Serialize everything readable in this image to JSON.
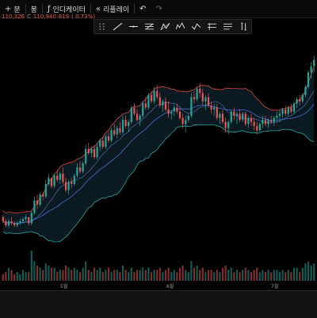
{
  "toolbar": {
    "timeframe": "분",
    "chart_type_label": "봉",
    "indicators_label": "인디케이터",
    "replay_label": "리플레이",
    "undo": "undo-icon",
    "redo": "redo-icon"
  },
  "ohlc": {
    "fragment1": "110,326",
    "close_prefix": "C",
    "close_value": "110,940",
    "change": "819",
    "change_pct": "( 0.73%)"
  },
  "drawing_tools": [
    "trend-line-icon",
    "horizontal-line-icon",
    "fib-retracement-icon",
    "pattern-icon",
    "elliott-wave-icon",
    "projection-icon",
    "brush-icon",
    "text-icon",
    "measure-icon"
  ],
  "x_axis": {
    "labels": [
      "5월",
      "6월",
      "7월"
    ]
  },
  "colors": {
    "up": "#26a69a",
    "down": "#ef5350",
    "band_upper": "#e0443b",
    "band_lower": "#26a69a",
    "middle": "#3a6bd6",
    "ma": "#6ea0ff",
    "band_fill": "#0c1d23"
  },
  "chart_data": {
    "type": "candlestick",
    "candles": [
      [
        100,
        101,
        97,
        98
      ],
      [
        98,
        99,
        95,
        96
      ],
      [
        96,
        99,
        95,
        98
      ],
      [
        98,
        100,
        96,
        97
      ],
      [
        97,
        98,
        95,
        96
      ],
      [
        96,
        98,
        95,
        97
      ],
      [
        97,
        99,
        96,
        98
      ],
      [
        98,
        100,
        97,
        99
      ],
      [
        99,
        101,
        98,
        100
      ],
      [
        100,
        99,
        96,
        97
      ],
      [
        97,
        103,
        96,
        102
      ],
      [
        102,
        110,
        101,
        108
      ],
      [
        108,
        111,
        104,
        106
      ],
      [
        106,
        112,
        105,
        111
      ],
      [
        111,
        112,
        108,
        110
      ],
      [
        110,
        118,
        109,
        116
      ],
      [
        116,
        121,
        115,
        119
      ],
      [
        119,
        118,
        114,
        115
      ],
      [
        115,
        121,
        114,
        120
      ],
      [
        120,
        123,
        117,
        118
      ],
      [
        118,
        122,
        116,
        121
      ],
      [
        121,
        124,
        116,
        117
      ],
      [
        117,
        119,
        112,
        113
      ],
      [
        113,
        118,
        111,
        117
      ],
      [
        117,
        119,
        114,
        116
      ],
      [
        116,
        121,
        115,
        120
      ],
      [
        120,
        126,
        119,
        124
      ],
      [
        124,
        127,
        121,
        122
      ],
      [
        122,
        127,
        121,
        126
      ],
      [
        126,
        135,
        125,
        133
      ],
      [
        133,
        136,
        130,
        131
      ],
      [
        131,
        134,
        129,
        133
      ],
      [
        133,
        135,
        128,
        129
      ],
      [
        129,
        136,
        128,
        134
      ],
      [
        134,
        138,
        132,
        137
      ],
      [
        137,
        139,
        133,
        134
      ],
      [
        134,
        140,
        133,
        139
      ],
      [
        139,
        141,
        136,
        137
      ],
      [
        137,
        143,
        136,
        142
      ],
      [
        142,
        145,
        139,
        140
      ],
      [
        140,
        144,
        138,
        143
      ],
      [
        143,
        146,
        140,
        141
      ],
      [
        141,
        149,
        140,
        147
      ],
      [
        147,
        149,
        143,
        144
      ],
      [
        144,
        147,
        141,
        146
      ],
      [
        146,
        154,
        145,
        153
      ],
      [
        153,
        155,
        149,
        150
      ],
      [
        150,
        152,
        146,
        147
      ],
      [
        147,
        150,
        144,
        149
      ],
      [
        149,
        156,
        148,
        155
      ],
      [
        155,
        158,
        152,
        153
      ],
      [
        153,
        160,
        152,
        159
      ],
      [
        159,
        161,
        155,
        156
      ],
      [
        156,
        163,
        155,
        161
      ],
      [
        161,
        164,
        157,
        158
      ],
      [
        158,
        160,
        153,
        154
      ],
      [
        154,
        157,
        151,
        156
      ],
      [
        156,
        158,
        151,
        152
      ],
      [
        152,
        156,
        148,
        150
      ],
      [
        150,
        152,
        147,
        151
      ],
      [
        151,
        154,
        149,
        153
      ],
      [
        153,
        155,
        150,
        151
      ],
      [
        151,
        153,
        147,
        148
      ],
      [
        148,
        150,
        143,
        145
      ],
      [
        145,
        149,
        141,
        147
      ],
      [
        147,
        150,
        146,
        149
      ],
      [
        149,
        160,
        148,
        158
      ],
      [
        158,
        161,
        155,
        157
      ],
      [
        157,
        163,
        156,
        162
      ],
      [
        162,
        165,
        158,
        160
      ],
      [
        160,
        162,
        154,
        156
      ],
      [
        156,
        159,
        152,
        158
      ],
      [
        158,
        160,
        153,
        154
      ],
      [
        154,
        156,
        150,
        152
      ],
      [
        152,
        155,
        149,
        153
      ],
      [
        153,
        155,
        147,
        148
      ],
      [
        148,
        151,
        145,
        150
      ],
      [
        150,
        152,
        145,
        146
      ],
      [
        146,
        148,
        141,
        143
      ],
      [
        143,
        147,
        140,
        146
      ],
      [
        146,
        152,
        145,
        151
      ],
      [
        151,
        153,
        147,
        149
      ],
      [
        149,
        151,
        145,
        150
      ],
      [
        150,
        152,
        146,
        147
      ],
      [
        147,
        151,
        146,
        150
      ],
      [
        150,
        151,
        144,
        145
      ],
      [
        145,
        149,
        143,
        148
      ],
      [
        148,
        150,
        144,
        146
      ],
      [
        146,
        148,
        142,
        144
      ],
      [
        144,
        146,
        140,
        142
      ],
      [
        142,
        146,
        141,
        145
      ],
      [
        145,
        149,
        143,
        147
      ],
      [
        147,
        149,
        144,
        145
      ],
      [
        145,
        148,
        143,
        147
      ],
      [
        147,
        149,
        145,
        146
      ],
      [
        146,
        149,
        144,
        148
      ],
      [
        148,
        151,
        146,
        149
      ],
      [
        149,
        152,
        146,
        150
      ],
      [
        150,
        153,
        148,
        152
      ],
      [
        152,
        154,
        149,
        150
      ],
      [
        150,
        154,
        149,
        153
      ],
      [
        153,
        155,
        150,
        151
      ],
      [
        151,
        156,
        150,
        155
      ],
      [
        155,
        158,
        153,
        157
      ],
      [
        157,
        159,
        154,
        156
      ],
      [
        156,
        160,
        155,
        159
      ],
      [
        159,
        164,
        158,
        163
      ],
      [
        163,
        171,
        162,
        170
      ],
      [
        170,
        175,
        167,
        173
      ],
      [
        173,
        178,
        170,
        176
      ]
    ],
    "volumes": [
      3,
      4,
      6,
      5,
      3,
      4,
      3,
      5,
      4,
      4,
      14,
      9,
      7,
      6,
      5,
      8,
      7,
      6,
      6,
      4,
      5,
      5,
      7,
      6,
      5,
      6,
      5,
      4,
      6,
      9,
      5,
      4,
      6,
      5,
      6,
      4,
      5,
      6,
      4,
      5,
      5,
      4,
      7,
      5,
      4,
      6,
      4,
      5,
      5,
      6,
      5,
      6,
      4,
      5,
      5,
      6,
      4,
      5,
      6,
      4,
      5,
      4,
      6,
      7,
      5,
      4,
      9,
      6,
      7,
      5,
      6,
      4,
      5,
      5,
      4,
      5,
      4,
      6,
      7,
      5,
      6,
      4,
      5,
      4,
      5,
      6,
      5,
      4,
      5,
      6,
      4,
      5,
      4,
      5,
      4,
      5,
      5,
      4,
      5,
      4,
      5,
      4,
      6,
      6,
      4,
      6,
      8,
      9,
      7,
      8
    ],
    "x_labels": [
      "5월",
      "6월",
      "7월"
    ]
  }
}
